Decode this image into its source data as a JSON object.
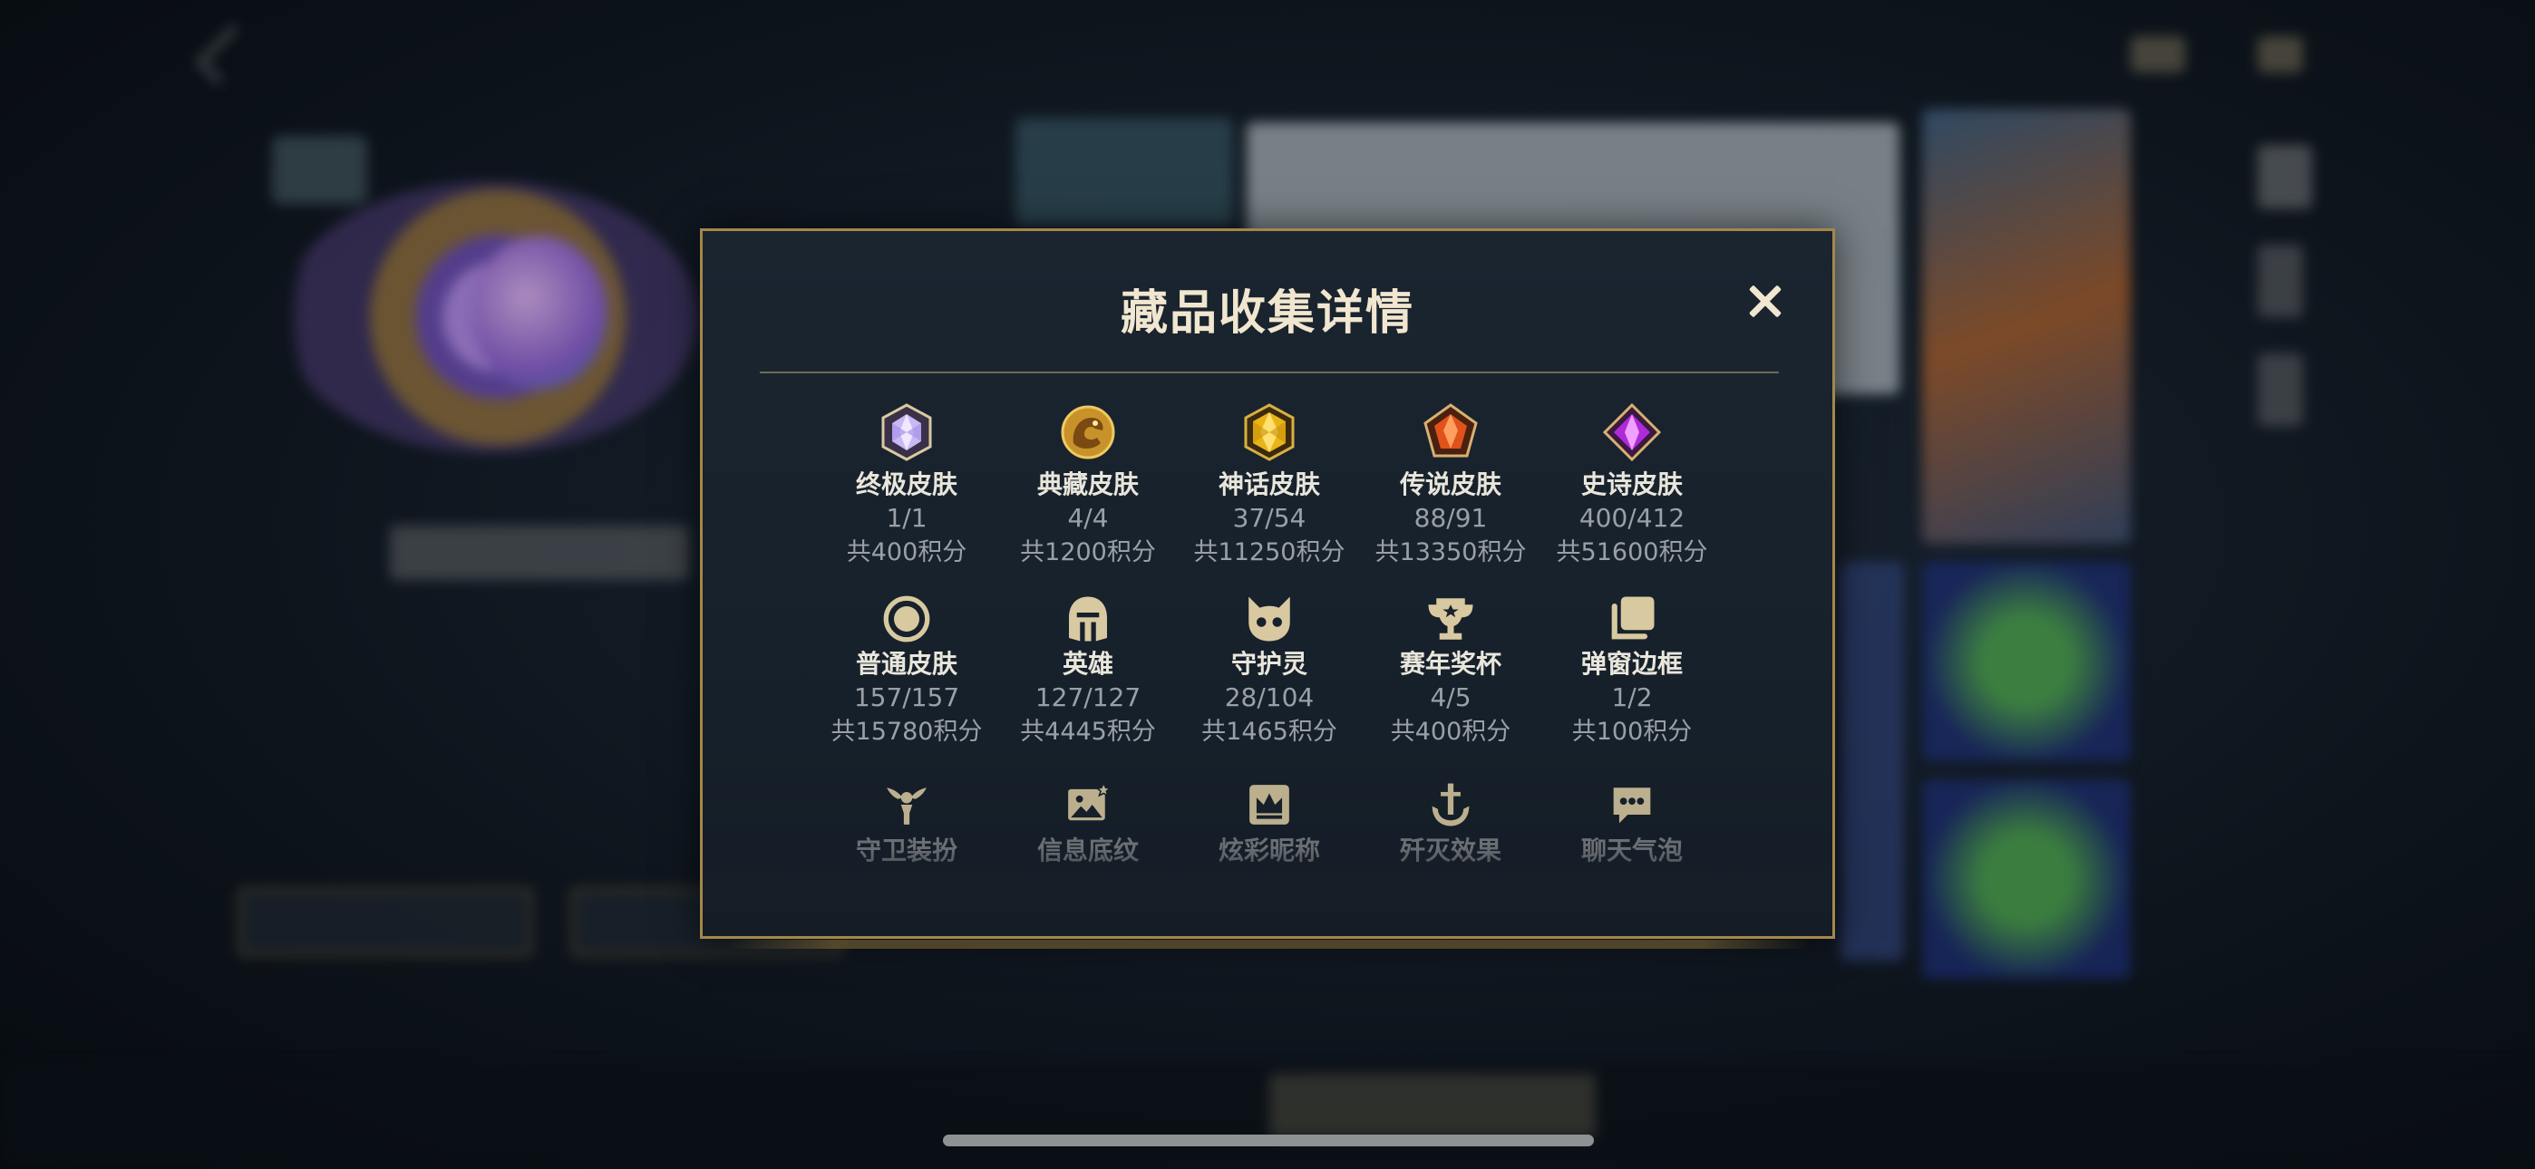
{
  "modal": {
    "title": "藏品收集详情",
    "close_symbol": "✕"
  },
  "collection_rows": [
    [
      {
        "icon": "ultimate-skin-gem-icon",
        "name": "终极皮肤",
        "count": "1/1",
        "points": "共400积分"
      },
      {
        "icon": "legacy-skin-dragon-icon",
        "name": "典藏皮肤",
        "count": "4/4",
        "points": "共1200积分"
      },
      {
        "icon": "mythic-skin-gem-icon",
        "name": "神话皮肤",
        "count": "37/54",
        "points": "共11250积分"
      },
      {
        "icon": "legendary-skin-gem-icon",
        "name": "传说皮肤",
        "count": "88/91",
        "points": "共13350积分"
      },
      {
        "icon": "epic-skin-gem-icon",
        "name": "史诗皮肤",
        "count": "400/412",
        "points": "共51600积分"
      }
    ],
    [
      {
        "icon": "normal-skin-circle-icon",
        "name": "普通皮肤",
        "count": "157/157",
        "points": "共15780积分"
      },
      {
        "icon": "champion-helmet-icon",
        "name": "英雄",
        "count": "127/127",
        "points": "共4445积分"
      },
      {
        "icon": "little-legend-icon",
        "name": "守护灵",
        "count": "28/104",
        "points": "共1465积分"
      },
      {
        "icon": "season-trophy-icon",
        "name": "赛年奖杯",
        "count": "4/5",
        "points": "共400积分"
      },
      {
        "icon": "popup-frame-icon",
        "name": "弹窗边框",
        "count": "1/2",
        "points": "共100积分"
      }
    ],
    [
      {
        "icon": "ward-skin-icon",
        "name": "守卫装扮"
      },
      {
        "icon": "info-banner-icon",
        "name": "信息底纹"
      },
      {
        "icon": "colorful-nickname-crown-icon",
        "name": "炫彩昵称"
      },
      {
        "icon": "ace-effect-anchor-icon",
        "name": "歼灭效果"
      },
      {
        "icon": "chat-bubble-icon",
        "name": "聊天气泡"
      }
    ]
  ],
  "colors": {
    "gold": "#a4874a",
    "title": "#f1e6cf",
    "icon_gold": "#d8c9a0"
  }
}
